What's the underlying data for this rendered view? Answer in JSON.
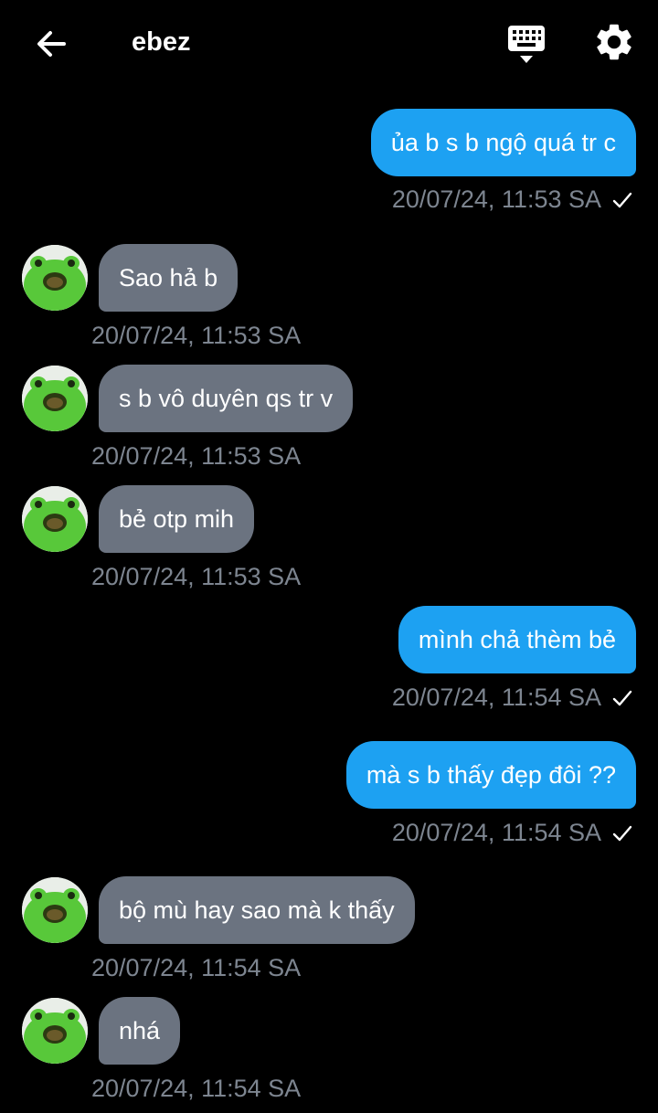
{
  "header": {
    "title": "ebez",
    "back_icon": "arrow-left-icon",
    "keyboard_icon": "keyboard-icon",
    "settings_icon": "gear-icon"
  },
  "colors": {
    "outgoing_bubble": "#1da1f2",
    "incoming_bubble": "#6b7380",
    "timestamp": "#7d8590",
    "background": "#000000"
  },
  "messages": [
    {
      "dir": "out",
      "text": "ủa b s b ngộ quá tr c",
      "time": "20/07/24, 11:53 SA",
      "read": true
    },
    {
      "dir": "in",
      "text": "Sao hả b",
      "time": "20/07/24, 11:53 SA"
    },
    {
      "dir": "in",
      "text": "s b vô duyên qs tr v",
      "time": "20/07/24, 11:53 SA"
    },
    {
      "dir": "in",
      "text": "bẻ otp mih",
      "time": "20/07/24, 11:53 SA"
    },
    {
      "dir": "out",
      "text": "mình chả thèm bẻ",
      "time": "20/07/24, 11:54 SA",
      "read": true
    },
    {
      "dir": "out",
      "text": "mà s b thấy đẹp đôi ??",
      "time": "20/07/24, 11:54 SA",
      "read": true
    },
    {
      "dir": "in",
      "text": "bộ mù hay sao mà k thấy",
      "time": "20/07/24, 11:54 SA"
    },
    {
      "dir": "in",
      "text": "nhá",
      "time": "20/07/24, 11:54 SA"
    }
  ]
}
